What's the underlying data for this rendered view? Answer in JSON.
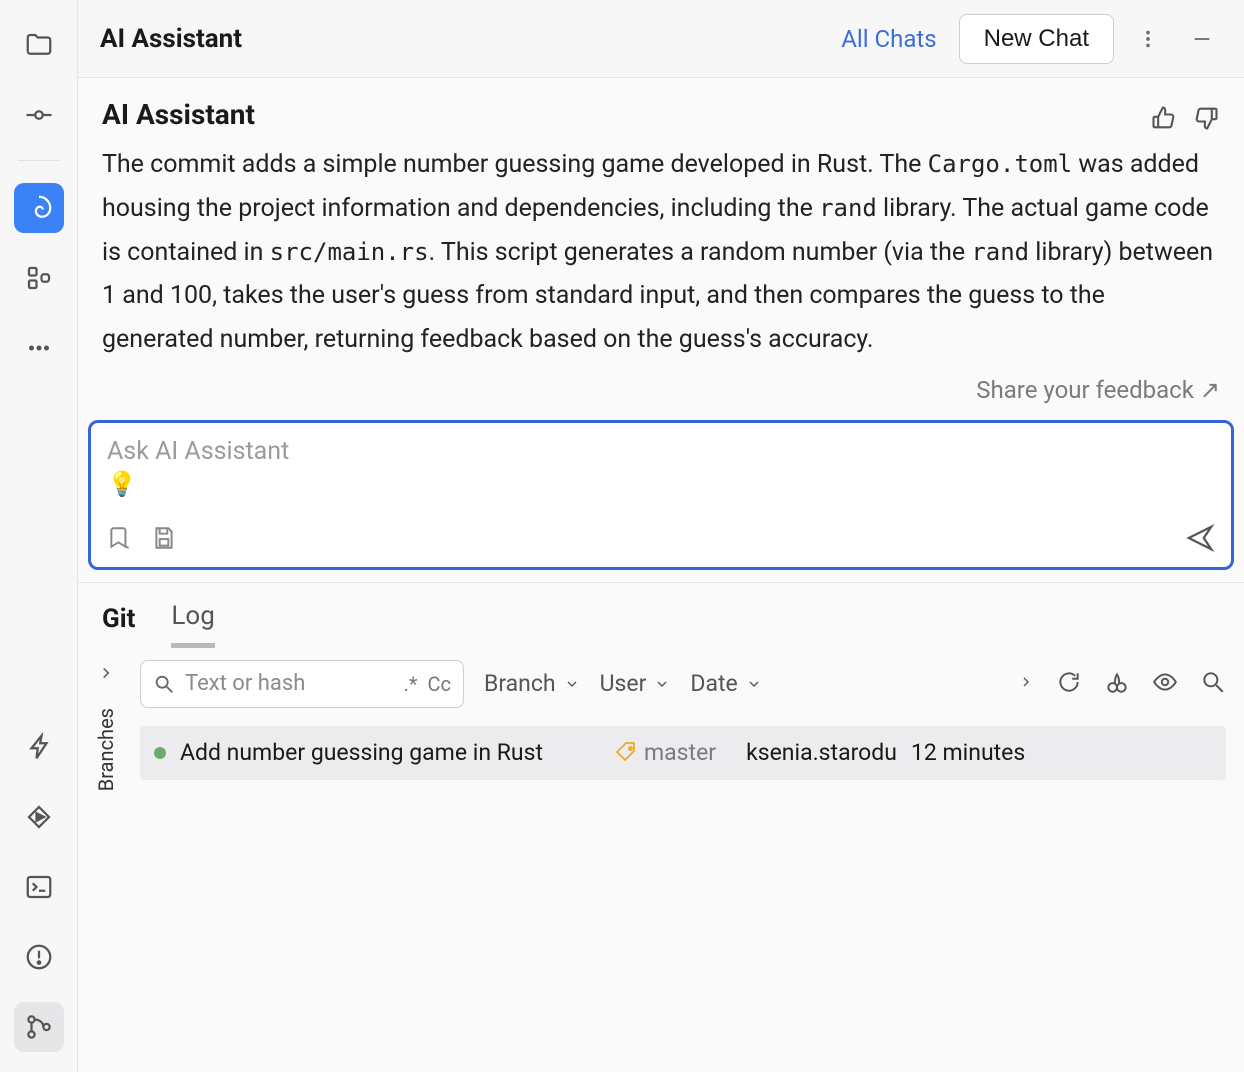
{
  "header": {
    "title": "AI Assistant",
    "all_chats": "All Chats",
    "new_chat": "New Chat"
  },
  "chat": {
    "from": "AI Assistant",
    "body_parts": {
      "p0": "The commit adds a simple number guessing game developed in Rust. The ",
      "c0": "Cargo.toml",
      "p1": " was added housing the project information and dependencies, including the ",
      "c1": "rand",
      "p2": " library. The actual game code is contained in ",
      "c2": "src/main.rs",
      "p3": ". This script generates a random number (via the ",
      "c3": "rand",
      "p4": " library) between 1 and 100, takes the user's guess from standard input, and then compares the guess to the generated number, returning feedback based on the guess's accuracy."
    },
    "share": "Share your feedback",
    "share_arrow": "↗"
  },
  "input": {
    "placeholder": "Ask AI Assistant",
    "bulb": "💡"
  },
  "git": {
    "tab_git": "Git",
    "tab_log": "Log",
    "branches_label": "Branches",
    "search_placeholder": "Text or hash",
    "regex": ".*",
    "cc": "Cc",
    "filters": {
      "branch": "Branch",
      "user": "User",
      "date": "Date"
    },
    "commit": {
      "message": "Add number guessing game in Rust",
      "branch": "master",
      "author": "ksenia.starodu",
      "time": "12 minutes"
    }
  }
}
